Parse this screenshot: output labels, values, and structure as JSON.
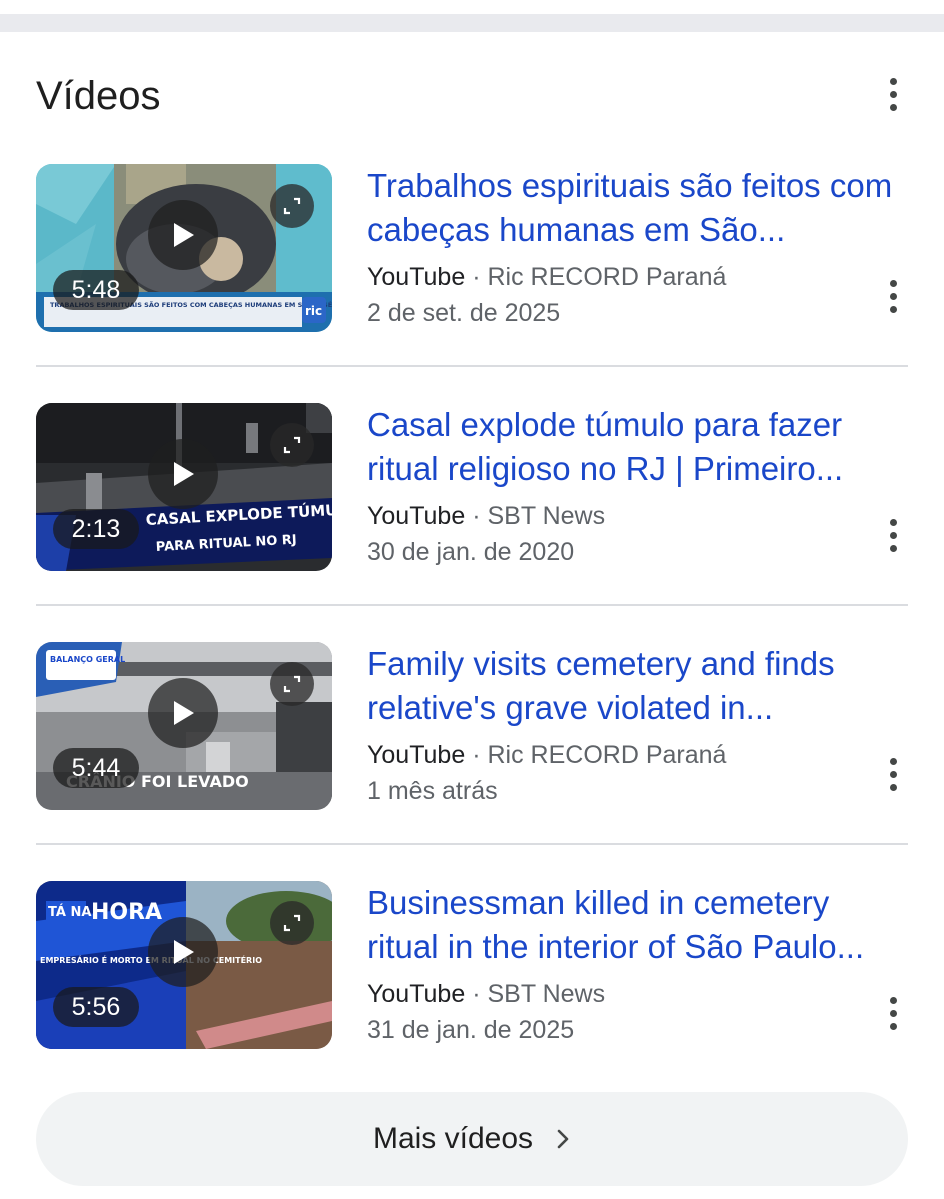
{
  "section": {
    "title": "Vídeos"
  },
  "videos": [
    {
      "title": "Trabalhos espirituais são feitos com cabeças humanas em São...",
      "source": "YouTube",
      "channel": "Ric RECORD Paraná",
      "date": "2 de set. de 2025",
      "duration": "5:48",
      "thumb_caption": "TRABALHOS ESPIRITUAIS SÃO FEITOS COM CABEÇAS HUMANAS EM SÃO JOSÉ DOS PINHAIS: SUSPEITA DE CEMITÉRIO VIOLADO",
      "thumb_logo": "ric"
    },
    {
      "title": "Casal explode túmulo para fazer ritual religioso no RJ | Primeiro...",
      "source": "YouTube",
      "channel": "SBT News",
      "date": "30 de jan. de 2020",
      "duration": "2:13",
      "thumb_caption_1": "CASAL EXPLODE TÚMULO",
      "thumb_caption_2": "PARA RITUAL NO RJ"
    },
    {
      "title": "Family visits cemetery and finds relative's grave violated in...",
      "source": "YouTube",
      "channel": "Ric RECORD Paraná",
      "date": "1 mês atrás",
      "duration": "5:44",
      "thumb_badge": "BALANÇO GERAL",
      "thumb_caption": "CRÂNIO FOI LEVADO"
    },
    {
      "title": "Businessman killed in cemetery ritual in the interior of São Paulo...",
      "source": "YouTube",
      "channel": "SBT News",
      "date": "31 de jan. de 2025",
      "duration": "5:56",
      "thumb_badge_1": "TÁ NA",
      "thumb_badge_2": "HORA",
      "thumb_caption": "EMPRESÁRIO É MORTO EM RITUAL NO CEMITÉRIO"
    }
  ],
  "separator": "·",
  "more_button": {
    "label": "Mais vídeos"
  },
  "colors": {
    "link": "#1a47c9",
    "meta": "#5f6368",
    "divider": "#dadce0",
    "more_bg": "#f1f3f4"
  }
}
